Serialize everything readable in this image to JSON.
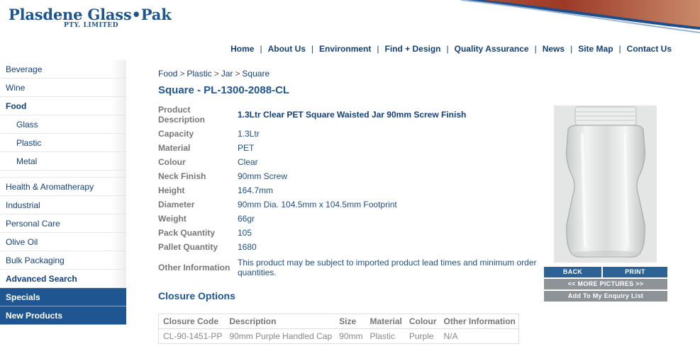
{
  "header": {
    "logo_main": "Plasdene Glass•Pak",
    "logo_sub": "PTY. LIMITED"
  },
  "topnav": [
    "Home",
    "About Us",
    "Environment",
    "Find + Design",
    "Quality Assurance",
    "News",
    "Site Map",
    "Contact Us"
  ],
  "topnav_separator": "|",
  "sidebar": {
    "items": [
      {
        "label": "Beverage"
      },
      {
        "label": "Wine"
      },
      {
        "label": "Food"
      },
      {
        "label": "Glass"
      },
      {
        "label": "Plastic"
      },
      {
        "label": "Metal"
      },
      {
        "label": "Health & Aromatherapy"
      },
      {
        "label": "Industrial"
      },
      {
        "label": "Personal Care"
      },
      {
        "label": "Olive Oil"
      },
      {
        "label": "Bulk Packaging"
      },
      {
        "label": "Advanced Search"
      },
      {
        "label": "Specials"
      },
      {
        "label": "New Products"
      }
    ]
  },
  "breadcrumb": {
    "items": [
      "Food",
      "Plastic",
      "Jar",
      "Square"
    ],
    "separator": ">"
  },
  "page_title": "Square - PL-1300-2088-CL",
  "spec": {
    "rows": [
      {
        "label": "Product Description",
        "value": "1.3Ltr Clear PET Square Waisted Jar 90mm Screw Finish"
      },
      {
        "label": "Capacity",
        "value": "1.3Ltr"
      },
      {
        "label": "Material",
        "value": "PET"
      },
      {
        "label": "Colour",
        "value": "Clear"
      },
      {
        "label": "Neck Finish",
        "value": "90mm Screw"
      },
      {
        "label": "Height",
        "value": "164.7mm"
      },
      {
        "label": "Diameter",
        "value": "90mm Dia. 104.5mm x 104.5mm Footprint"
      },
      {
        "label": "Weight",
        "value": "66gr"
      },
      {
        "label": "Pack Quantity",
        "value": "105"
      },
      {
        "label": "Pallet Quantity",
        "value": "1680"
      },
      {
        "label": "Other Information",
        "value": "This product may be subject to imported product lead times and minimum order quantities."
      }
    ]
  },
  "closure": {
    "heading": "Closure Options",
    "columns": [
      "Closure Code",
      "Description",
      "Size",
      "Material",
      "Colour",
      "Other Information"
    ],
    "rows": [
      [
        "CL-90-1451-PP",
        "90mm Purple Handled Cap",
        "90mm",
        "Plastic",
        "Purple",
        "N/A"
      ]
    ]
  },
  "buttons": {
    "back": "BACK",
    "print": "PRINT",
    "more_pictures": "<< MORE PICTURES >>",
    "enquiry": "Add To My Enquiry List"
  },
  "colors": {
    "brand_blue": "#1f5691",
    "button_blue": "#2d6296",
    "button_grey": "#8e9398",
    "label_grey": "#777777"
  }
}
